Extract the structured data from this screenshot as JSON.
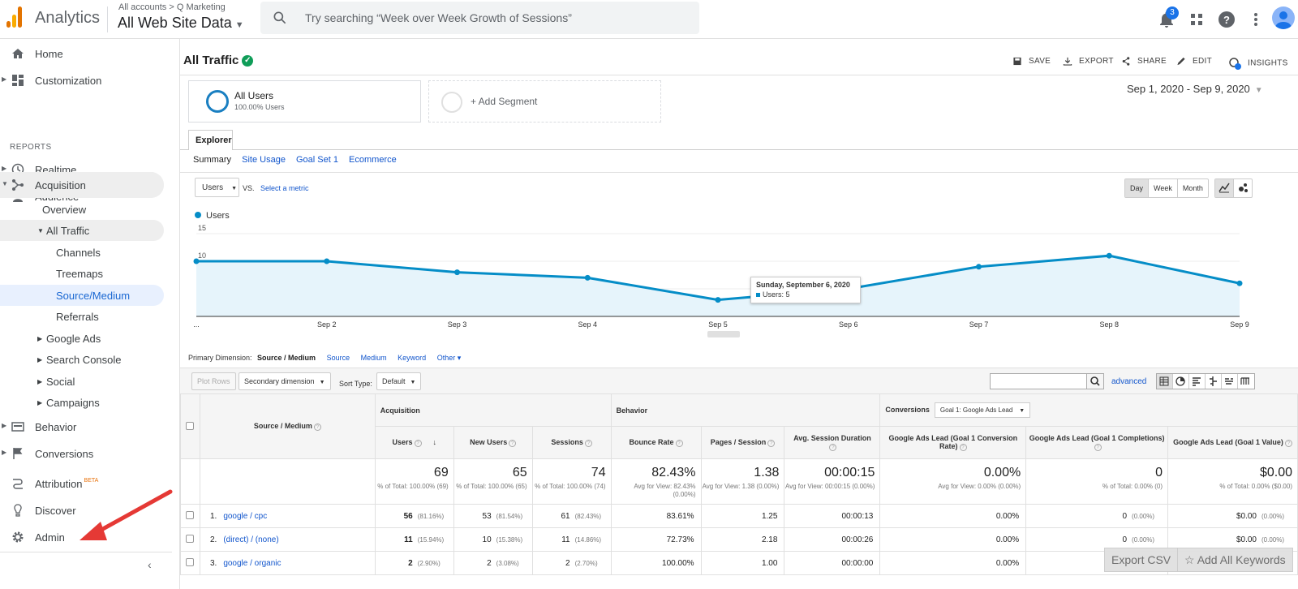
{
  "header": {
    "app_title": "Analytics",
    "breadcrumb": "All accounts > Q Marketing",
    "property": "All Web Site Data",
    "search_placeholder": "Try searching “Week over Week Growth of Sessions”",
    "notification_count": "3"
  },
  "sidebar": {
    "home": "Home",
    "customization": "Customization",
    "reports_heading": "REPORTS",
    "realtime": "Realtime",
    "audience": "Audience",
    "acquisition": "Acquisition",
    "overview": "Overview",
    "all_traffic": "All Traffic",
    "channels": "Channels",
    "treemaps": "Treemaps",
    "source_medium": "Source/Medium",
    "referrals": "Referrals",
    "google_ads": "Google Ads",
    "search_console": "Search Console",
    "social": "Social",
    "campaigns": "Campaigns",
    "behavior": "Behavior",
    "conversions": "Conversions",
    "attribution": "Attribution",
    "beta": "BETA",
    "discover": "Discover",
    "admin": "Admin"
  },
  "report": {
    "title": "All Traffic",
    "actions": {
      "save": "SAVE",
      "export": "EXPORT",
      "share": "SHARE",
      "edit": "EDIT",
      "insights": "INSIGHTS"
    },
    "segment_name": "All Users",
    "segment_pct": "100.00% Users",
    "add_segment": "+ Add Segment",
    "date_range": "Sep 1, 2020 - Sep 9, 2020",
    "tab_explorer": "Explorer",
    "subtabs": [
      "Summary",
      "Site Usage",
      "Goal Set 1",
      "Ecommerce"
    ],
    "metric": "Users",
    "vs": "VS.",
    "select_metric": "Select a metric",
    "granularity": [
      "Day",
      "Week",
      "Month"
    ],
    "legend": "Users",
    "tooltip_title": "Sunday, September 6, 2020",
    "tooltip_value": "Users: 5",
    "primary_dimension_label": "Primary Dimension:",
    "dimensions": [
      "Source / Medium",
      "Source",
      "Medium",
      "Keyword",
      "Other ▾"
    ],
    "plot_rows": "Plot Rows",
    "secondary_dimension": "Secondary dimension",
    "sort_type_label": "Sort Type:",
    "sort_type": "Default",
    "advanced": "advanced",
    "export_csv": "Export CSV",
    "add_keywords": "Add All Keywords"
  },
  "chart_data": {
    "type": "area",
    "x": [
      "...",
      "Sep 2",
      "Sep 3",
      "Sep 4",
      "Sep 5",
      "Sep 6",
      "Sep 7",
      "Sep 8",
      "Sep 9"
    ],
    "series": [
      {
        "name": "Users",
        "values": [
          10,
          10,
          8,
          7,
          3,
          5,
          9,
          11,
          6
        ]
      }
    ],
    "yticks": [
      "15",
      "10",
      "5"
    ],
    "ylim": [
      0,
      15
    ],
    "color": "#058dc7"
  },
  "table": {
    "dim_header": "Source / Medium",
    "groups": {
      "acquisition": "Acquisition",
      "behavior": "Behavior",
      "conversions": "Conversions",
      "goal_select": "Goal 1: Google Ads Lead"
    },
    "columns": [
      "Users",
      "New Users",
      "Sessions",
      "Bounce Rate",
      "Pages / Session",
      "Avg. Session Duration",
      "Google Ads Lead (Goal 1 Conversion Rate)",
      "Google Ads Lead (Goal 1 Completions)",
      "Google Ads Lead (Goal 1 Value)"
    ],
    "totals": [
      {
        "big": "69",
        "sub": "% of Total: 100.00% (69)"
      },
      {
        "big": "65",
        "sub": "% of Total: 100.00% (65)"
      },
      {
        "big": "74",
        "sub": "% of Total: 100.00% (74)"
      },
      {
        "big": "82.43%",
        "sub": "Avg for View: 82.43% (0.00%)"
      },
      {
        "big": "1.38",
        "sub": "Avg for View: 1.38 (0.00%)"
      },
      {
        "big": "00:00:15",
        "sub": "Avg for View: 00:00:15 (0.00%)"
      },
      {
        "big": "0.00%",
        "sub": "Avg for View: 0.00% (0.00%)"
      },
      {
        "big": "0",
        "sub": "% of Total: 0.00% (0)"
      },
      {
        "big": "$0.00",
        "sub": "% of Total: 0.00% ($0.00)"
      }
    ],
    "rows": [
      {
        "idx": "1.",
        "source": "google / cpc",
        "users": "56",
        "users_p": "(81.16%)",
        "new": "53",
        "new_p": "(81.54%)",
        "sessions": "61",
        "sessions_p": "(82.43%)",
        "bounce": "83.61%",
        "pps": "1.25",
        "dur": "00:00:13",
        "rate": "0.00%",
        "comp": "0",
        "comp_p": "(0.00%)",
        "val": "$0.00",
        "val_p": "(0.00%)"
      },
      {
        "idx": "2.",
        "source": "(direct) / (none)",
        "users": "11",
        "users_p": "(15.94%)",
        "new": "10",
        "new_p": "(15.38%)",
        "sessions": "11",
        "sessions_p": "(14.86%)",
        "bounce": "72.73%",
        "pps": "2.18",
        "dur": "00:00:26",
        "rate": "0.00%",
        "comp": "0",
        "comp_p": "(0.00%)",
        "val": "$0.00",
        "val_p": "(0.00%)"
      },
      {
        "idx": "3.",
        "source": "google / organic",
        "users": "2",
        "users_p": "(2.90%)",
        "new": "2",
        "new_p": "(3.08%)",
        "sessions": "2",
        "sessions_p": "(2.70%)",
        "bounce": "100.00%",
        "pps": "1.00",
        "dur": "00:00:00",
        "rate": "0.00%",
        "comp": "",
        "comp_p": "",
        "val": "",
        "val_p": ""
      }
    ]
  }
}
